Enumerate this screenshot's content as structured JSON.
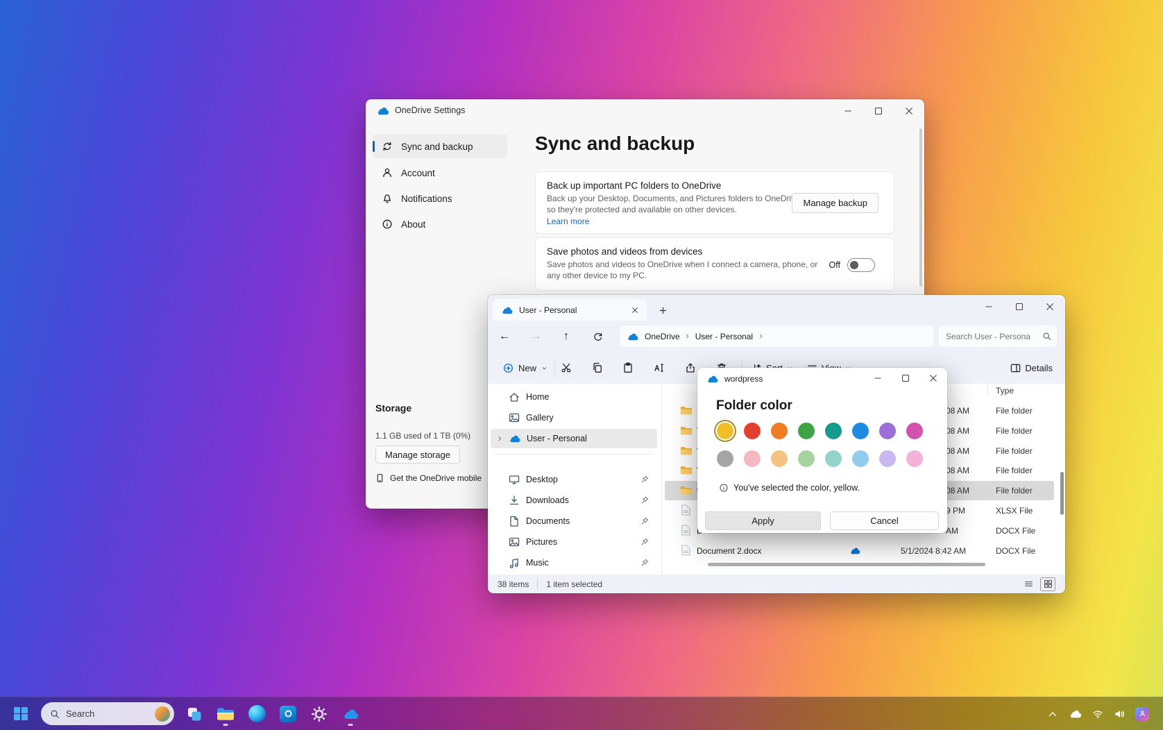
{
  "settings_window": {
    "title": "OneDrive Settings",
    "nav": [
      {
        "label": "Sync and backup"
      },
      {
        "label": "Account"
      },
      {
        "label": "Notifications"
      },
      {
        "label": "About"
      }
    ],
    "page_title": "Sync and backup",
    "backup_card": {
      "title": "Back up important PC folders to OneDrive",
      "description": "Back up your Desktop, Documents, and Pictures folders to OneDrive, so they're protected and available on other devices.",
      "learn_more": "Learn more",
      "manage_button": "Manage backup"
    },
    "photos_card": {
      "title": "Save photos and videos from devices",
      "description": "Save photos and videos to OneDrive when I connect a camera, phone, or any other device to my PC.",
      "toggle_state": "Off"
    },
    "storage": {
      "title": "Storage",
      "usage": "1.1 GB used of 1 TB (0%)",
      "manage_button": "Manage storage",
      "mobile_link": "Get the OneDrive mobile"
    }
  },
  "explorer": {
    "tab_title": "User - Personal",
    "breadcrumb": {
      "root": "OneDrive",
      "current": "User - Personal"
    },
    "search_value": "Search User - Persona",
    "toolbar": {
      "new_label": "New",
      "sort_label": "Sort",
      "view_label": "View",
      "details_label": "Details"
    },
    "sidebar": [
      {
        "label": "Home"
      },
      {
        "label": "Gallery"
      },
      {
        "label": "User - Personal"
      },
      {
        "label": "Desktop"
      },
      {
        "label": "Downloads"
      },
      {
        "label": "Documents"
      },
      {
        "label": "Pictures"
      },
      {
        "label": "Music"
      }
    ],
    "columns": {
      "name": "Na",
      "type": "Type"
    },
    "rows": [
      {
        "name": "S",
        "date": "08 AM",
        "type": "File folder"
      },
      {
        "name": "V",
        "date": "08 AM",
        "type": "File folder"
      },
      {
        "name": "W",
        "date": "08 AM",
        "type": "File folder"
      },
      {
        "name": "W",
        "date": "08 AM",
        "type": "File folder"
      },
      {
        "name": "w",
        "date": "08 AM",
        "type": "File folder"
      },
      {
        "name": "B",
        "date": "9 PM",
        "type": "XLSX File"
      },
      {
        "name": "D",
        "date": "AM",
        "type": "DOCX File"
      },
      {
        "name": "Document 2.docx",
        "date": "5/1/2024 8:42 AM",
        "type": "DOCX File"
      }
    ],
    "status": {
      "count": "38 items",
      "selection": "1 item selected"
    }
  },
  "color_dialog": {
    "title": "wordpress",
    "heading": "Folder color",
    "palette_row1": [
      {
        "name": "yellow",
        "hex": "#F0BE25"
      },
      {
        "name": "red",
        "hex": "#E23F30"
      },
      {
        "name": "orange",
        "hex": "#EF7E23"
      },
      {
        "name": "green",
        "hex": "#3FA346"
      },
      {
        "name": "teal",
        "hex": "#159A8C"
      },
      {
        "name": "blue",
        "hex": "#1E8BE0"
      },
      {
        "name": "purple",
        "hex": "#9C6FD6"
      },
      {
        "name": "magenta",
        "hex": "#D053AC"
      }
    ],
    "palette_row2": [
      {
        "name": "gray",
        "hex": "#A6A6A6"
      },
      {
        "name": "light-pink",
        "hex": "#F5B8BE"
      },
      {
        "name": "peach",
        "hex": "#F4C383"
      },
      {
        "name": "light-green",
        "hex": "#A4D39D"
      },
      {
        "name": "light-teal",
        "hex": "#93D3CB"
      },
      {
        "name": "light-blue",
        "hex": "#93CBEF"
      },
      {
        "name": "lavender",
        "hex": "#C9B7EF"
      },
      {
        "name": "pink",
        "hex": "#F2B2D9"
      }
    ],
    "info_text": "You've selected the color, yellow.",
    "apply_button": "Apply",
    "cancel_button": "Cancel"
  },
  "taskbar": {
    "search_placeholder": "Search"
  }
}
